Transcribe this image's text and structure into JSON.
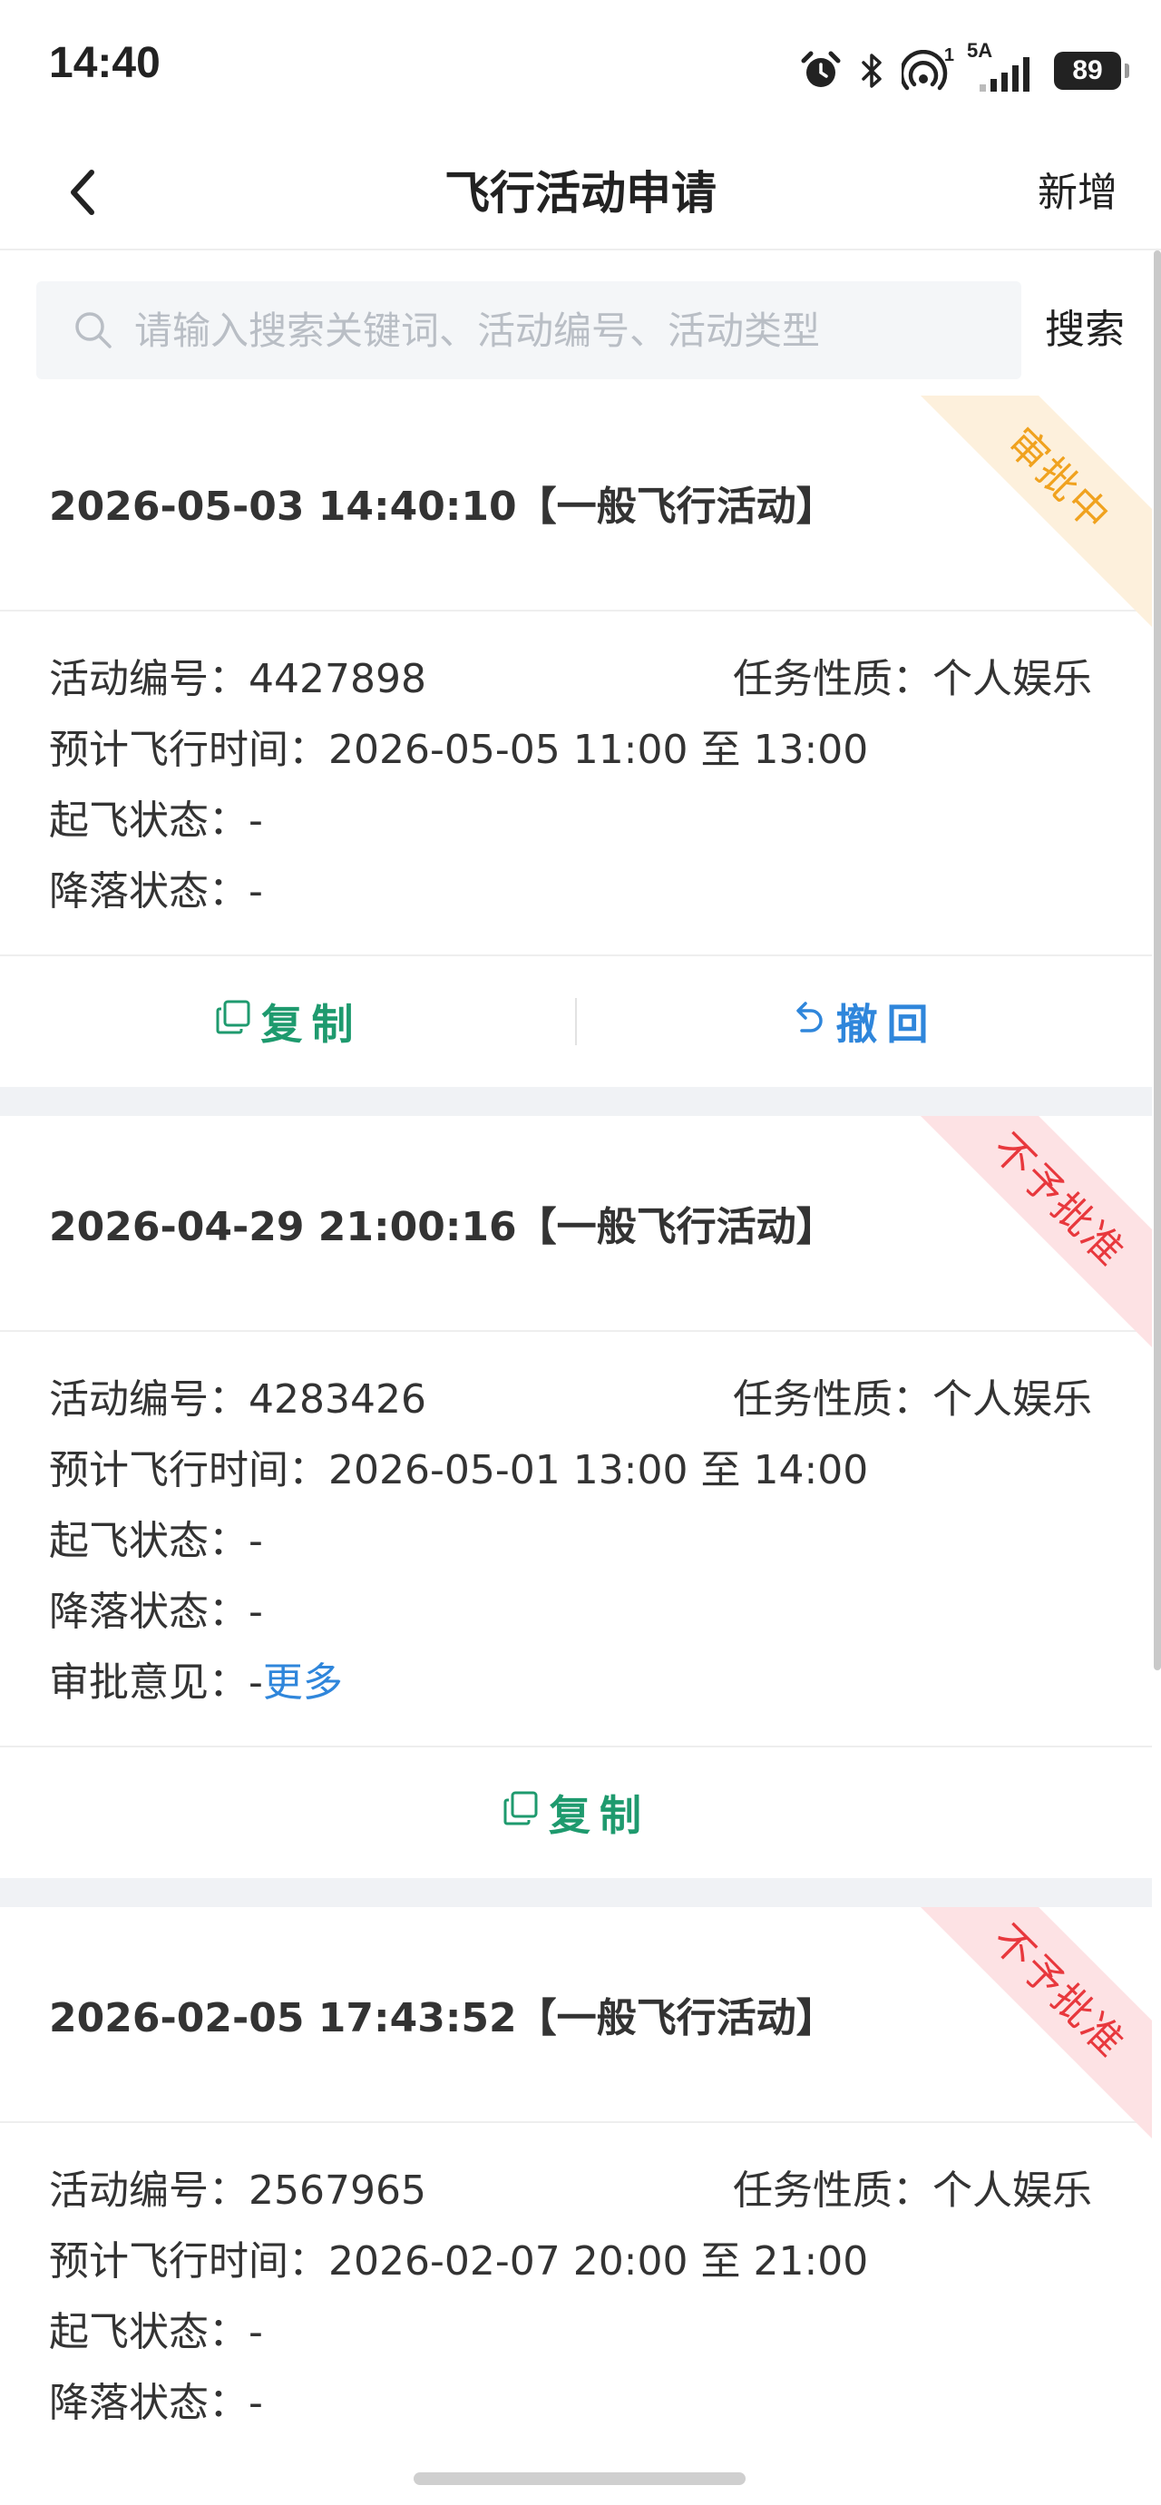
{
  "status_bar": {
    "time": "14:40",
    "net_type": "5A",
    "net_sup": "1",
    "battery": "89",
    "icons": [
      "alarm-icon",
      "bluetooth-icon",
      "hotspot-icon",
      "signal-icon",
      "battery-icon"
    ]
  },
  "header": {
    "title": "飞行活动申请",
    "add_label": "新增",
    "back_icon": "chevron-left-icon"
  },
  "search": {
    "placeholder": "请输入搜索关键词、活动编号、活动类型",
    "value": "",
    "button_label": "搜索"
  },
  "labels": {
    "activity_no": "活动编号：",
    "task_nature": "任务性质：",
    "planned_time": "预计飞行时间：",
    "takeoff_status": "起飞状态：",
    "landing_status": "降落状态：",
    "approval_opinion": "审批意见："
  },
  "cards": [
    {
      "title": "2026-05-03 14:40:10【一般飞行活动】",
      "ribbon": "审批中",
      "activity_no": "4427898",
      "task_nature": "个人娱乐",
      "planned_time": "2026-05-05 11:00 至 13:00",
      "takeoff_status": "-",
      "landing_status": "-",
      "copy_label": "复制",
      "revoke_label": "撤回"
    },
    {
      "title": "2026-04-29 21:00:16【一般飞行活动】",
      "ribbon": "不予批准",
      "activity_no": "4283426",
      "task_nature": "个人娱乐",
      "planned_time": "2026-05-01 13:00 至 14:00",
      "takeoff_status": "-",
      "landing_status": "-",
      "approval_opinion": "-",
      "more_label": "更多",
      "copy_label": "复制"
    },
    {
      "title": "2026-02-05 17:43:52【一般飞行活动】",
      "ribbon": "不予批准",
      "activity_no": "2567965",
      "task_nature": "个人娱乐",
      "planned_time": "2026-02-07 20:00 至 21:00",
      "takeoff_status": "-",
      "landing_status": "-"
    }
  ],
  "colors": {
    "pending": "#f0a21f",
    "rejected": "#e8383d",
    "copy_green": "#1e9a6e",
    "link_blue": "#2f86db"
  }
}
